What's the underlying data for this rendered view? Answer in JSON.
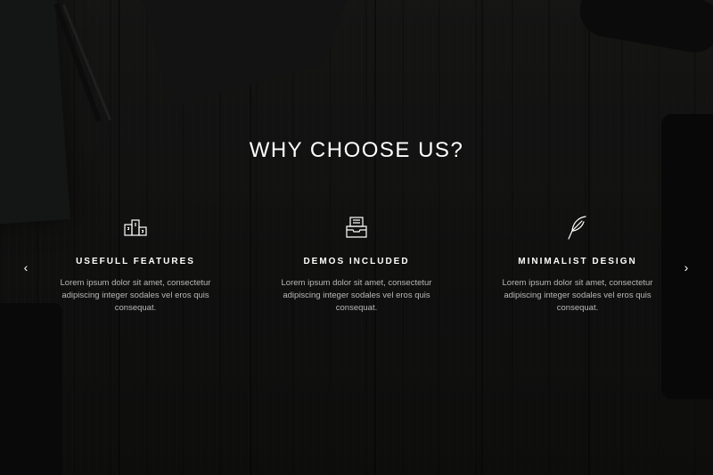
{
  "section": {
    "heading": "WHY CHOOSE US?"
  },
  "carousel": {
    "prev_icon": "chevron-left-icon",
    "next_icon": "chevron-right-icon",
    "prev_glyph": "‹",
    "next_glyph": "›"
  },
  "features": [
    {
      "icon": "podium-icon",
      "title": "USEFULL FEATURES",
      "description": "Lorem ipsum dolor sit amet, consectetur adipiscing integer sodales vel eros quis consequat."
    },
    {
      "icon": "inbox-tray-icon",
      "title": "DEMOS INCLUDED",
      "description": "Lorem ipsum dolor sit amet, consectetur adipiscing integer sodales vel eros quis consequat."
    },
    {
      "icon": "feather-icon",
      "title": "MINIMALIST DESIGN",
      "description": "Lorem ipsum dolor sit amet, consectetur adipiscing integer sodales vel eros quis consequat."
    }
  ],
  "colors": {
    "background": "#141414",
    "text": "#ffffff",
    "muted_text": "#b8b8b8"
  }
}
